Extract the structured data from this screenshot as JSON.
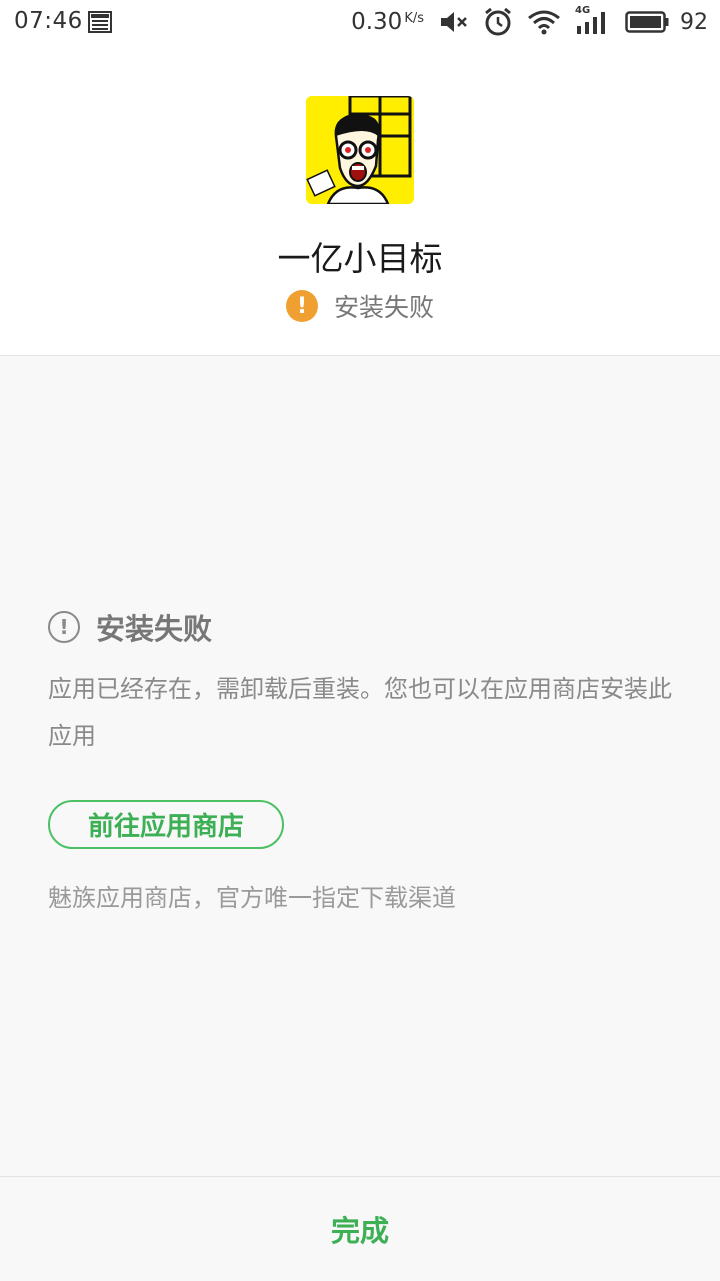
{
  "status_bar": {
    "time": "07:46",
    "speed": "0.30",
    "speed_unit": "K/s",
    "network": "4G",
    "battery": "92",
    "icons": [
      "news-icon",
      "mute-icon",
      "alarm-icon",
      "wifi-icon",
      "signal-icon",
      "battery-icon"
    ]
  },
  "app": {
    "name": "一亿小目标",
    "icon": "app-icon",
    "icon_bg": "#ffee00",
    "status": "安装失败"
  },
  "error": {
    "title": "安装失败",
    "message": "应用已经存在，需卸载后重装。您也可以在应用商店安装此应用"
  },
  "store": {
    "button_label": "前往应用商店",
    "note": "魅族应用商店，官方唯一指定下载渠道"
  },
  "footer": {
    "done_label": "完成"
  },
  "colors": {
    "accent_green": "#3daf55",
    "warning_orange": "#f0a030",
    "content_bg": "#f8f8f8"
  }
}
